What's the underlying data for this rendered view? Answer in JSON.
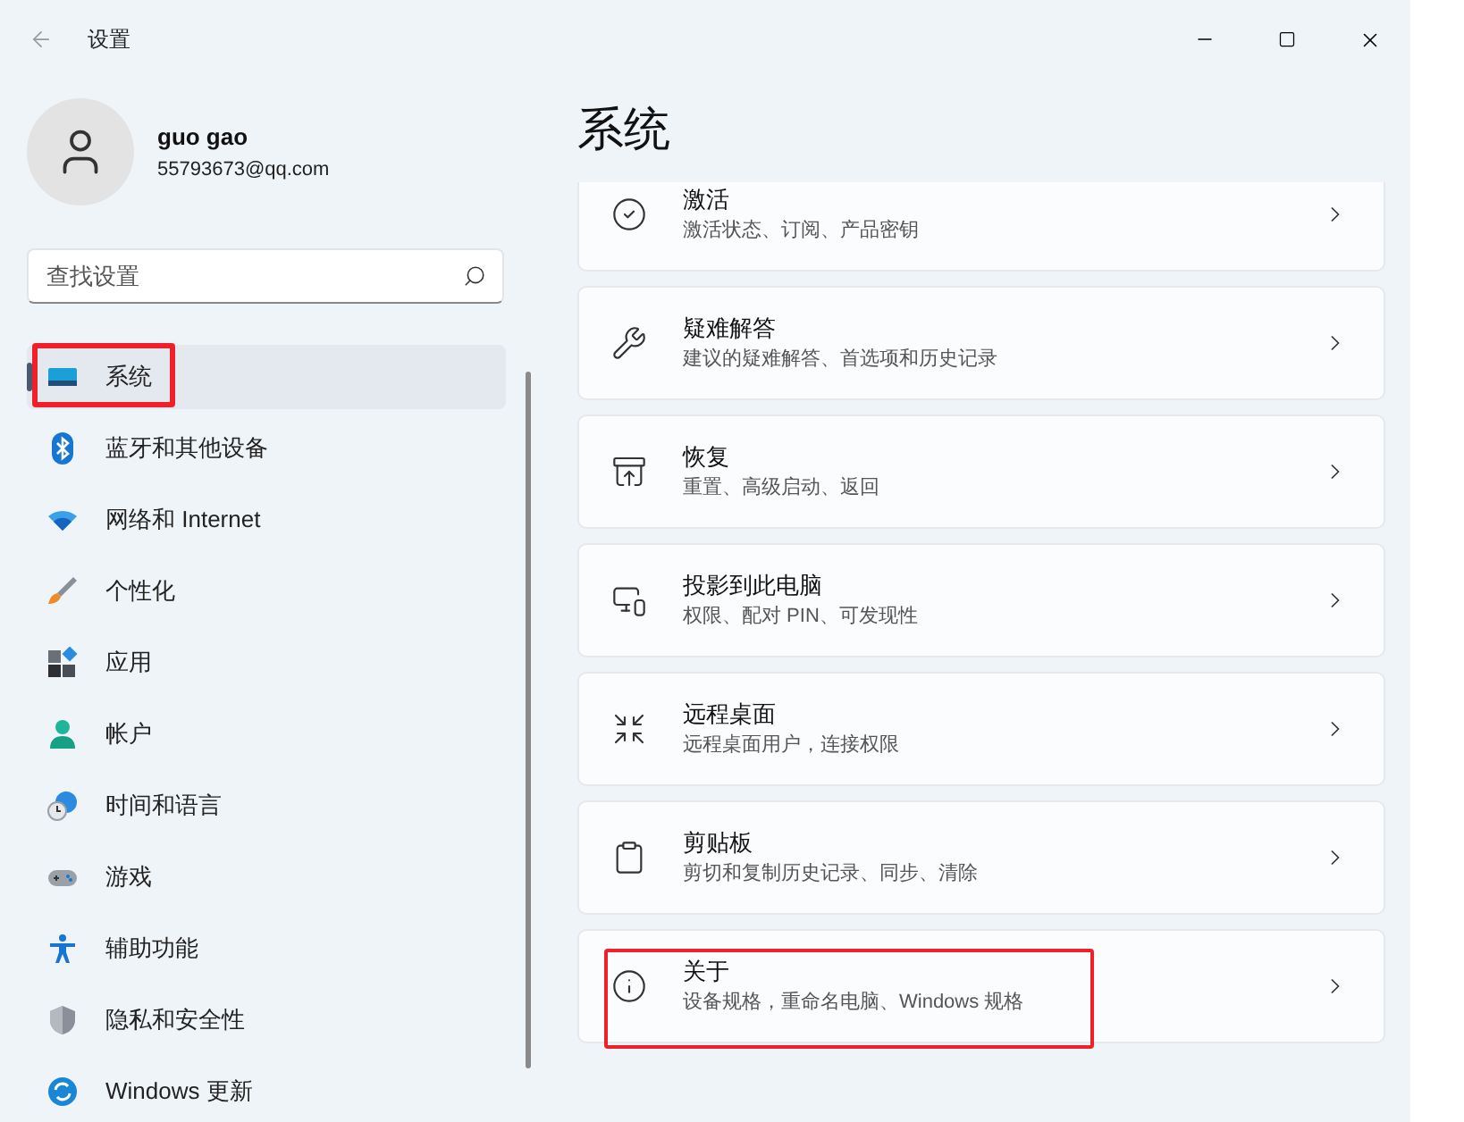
{
  "window": {
    "title": "设置"
  },
  "profile": {
    "name": "guo gao",
    "email": "55793673@qq.com"
  },
  "search": {
    "placeholder": "查找设置"
  },
  "nav": [
    {
      "label": "系统",
      "kind": "system",
      "selected": true,
      "highlighted": true
    },
    {
      "label": "蓝牙和其他设备",
      "kind": "bluetooth",
      "selected": false,
      "highlighted": false
    },
    {
      "label": "网络和 Internet",
      "kind": "wifi",
      "selected": false,
      "highlighted": false
    },
    {
      "label": "个性化",
      "kind": "brush",
      "selected": false,
      "highlighted": false
    },
    {
      "label": "应用",
      "kind": "apps",
      "selected": false,
      "highlighted": false
    },
    {
      "label": "帐户",
      "kind": "person",
      "selected": false,
      "highlighted": false
    },
    {
      "label": "时间和语言",
      "kind": "clock",
      "selected": false,
      "highlighted": false
    },
    {
      "label": "游戏",
      "kind": "gamepad",
      "selected": false,
      "highlighted": false
    },
    {
      "label": "辅助功能",
      "kind": "accessibility",
      "selected": false,
      "highlighted": false
    },
    {
      "label": "隐私和安全性",
      "kind": "shield",
      "selected": false,
      "highlighted": false
    },
    {
      "label": "Windows 更新",
      "kind": "update",
      "selected": false,
      "highlighted": false
    }
  ],
  "page": {
    "title": "系统"
  },
  "cards": [
    {
      "title": "激活",
      "subtitle": "激活状态、订阅、产品密钥",
      "kind": "check",
      "highlighted": false
    },
    {
      "title": "疑难解答",
      "subtitle": "建议的疑难解答、首选项和历史记录",
      "kind": "wrench",
      "highlighted": false
    },
    {
      "title": "恢复",
      "subtitle": "重置、高级启动、返回",
      "kind": "restore",
      "highlighted": false
    },
    {
      "title": "投影到此电脑",
      "subtitle": "权限、配对 PIN、可发现性",
      "kind": "project",
      "highlighted": false
    },
    {
      "title": "远程桌面",
      "subtitle": "远程桌面用户，连接权限",
      "kind": "remote",
      "highlighted": false
    },
    {
      "title": "剪贴板",
      "subtitle": "剪切和复制历史记录、同步、清除",
      "kind": "clipboard",
      "highlighted": false
    },
    {
      "title": "关于",
      "subtitle": "设备规格，重命名电脑、Windows 规格",
      "kind": "info",
      "highlighted": true
    }
  ]
}
